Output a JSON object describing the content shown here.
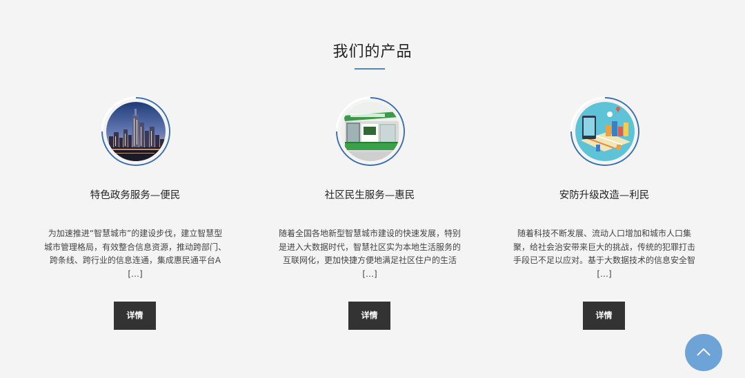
{
  "section": {
    "title": "我们的产品",
    "accent_color": "#4f86c0"
  },
  "products": [
    {
      "title": "特色政务服务—便民",
      "description": "为加速推进“智慧城市”的建设步伐，建立智慧型城市管理格局，有效整合信息资源，推动跨部门、跨条线、跨行业的信息连通，集成惠民通平台A […]",
      "button_label": "详情",
      "image": "city-night-skyline"
    },
    {
      "title": "社区民生服务—惠民",
      "description": "随着全国各地新型智慧城市建设的快速发展，特别是进入大数据时代，智慧社区实为本地生活服务的互联网化，更加快捷方便地满足社区住户的生活 […]",
      "button_label": "详情",
      "image": "community-kiosk"
    },
    {
      "title": "安防升级改造—利民",
      "description": "随着科技不断发展、流动人口增加和城市人口集聚，给社会治安带来巨大的挑战，传统的犯罪打击手段已不足以应对。基于大数据技术的信息安全智 […]",
      "button_label": "详情",
      "image": "smart-city-map"
    }
  ],
  "back_to_top": {
    "icon": "chevron-up-icon",
    "color": "#6ea3d8"
  }
}
